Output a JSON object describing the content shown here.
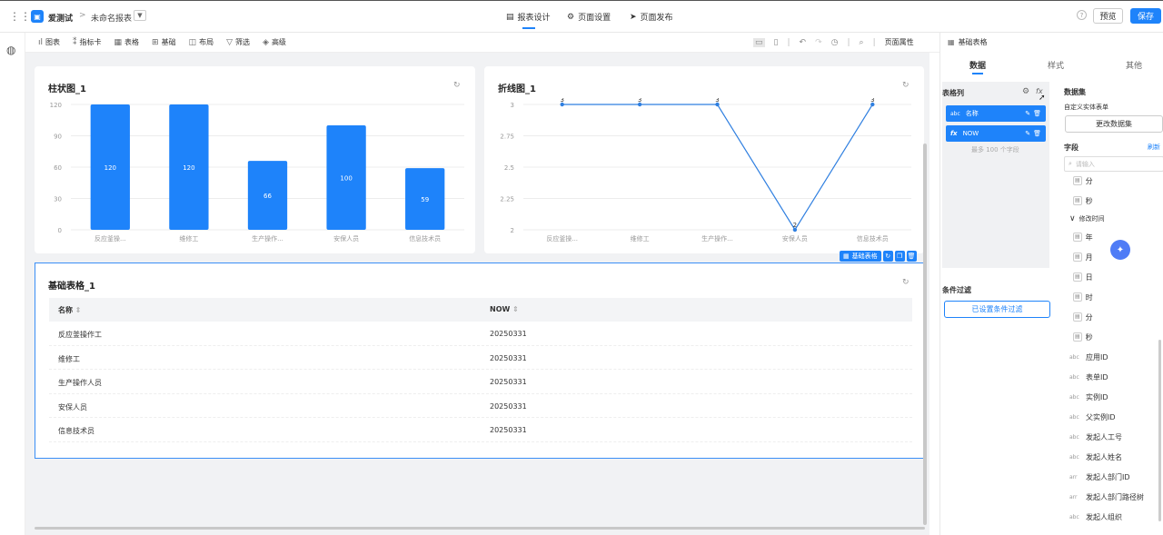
{
  "topbar": {
    "app_name": "爱测试",
    "breadcrumb_sep": ">",
    "report_name": "未命名报表",
    "tabs": [
      {
        "label": "报表设计",
        "active": true
      },
      {
        "label": "页面设置",
        "active": false
      },
      {
        "label": "页面发布",
        "active": false
      }
    ],
    "preview_label": "预览",
    "save_label": "保存"
  },
  "toolbar": {
    "items": [
      {
        "label": "图表",
        "icon": "bar-chart-icon"
      },
      {
        "label": "指标卡",
        "icon": "metric-card-icon"
      },
      {
        "label": "表格",
        "icon": "table-icon"
      },
      {
        "label": "基础",
        "icon": "grid-icon"
      },
      {
        "label": "布局",
        "icon": "layout-icon"
      },
      {
        "label": "筛选",
        "icon": "filter-icon"
      },
      {
        "label": "高级",
        "icon": "layers-icon"
      }
    ],
    "page_props_label": "页面属性"
  },
  "bar_chart": {
    "title": "柱状图_1",
    "chart_data": {
      "type": "bar",
      "categories": [
        "反应釜操...",
        "维修工",
        "生产操作...",
        "安保人员",
        "信息技术员"
      ],
      "values": [
        120,
        120,
        66,
        100,
        59
      ],
      "yticks": [
        0,
        30,
        60,
        90,
        120
      ],
      "ylim": [
        0,
        120
      ],
      "color": "#1e83fa"
    }
  },
  "line_chart": {
    "title": "折线图_1",
    "chart_data": {
      "type": "line",
      "categories": [
        "反应釜操...",
        "维修工",
        "生产操作...",
        "安保人员",
        "信息技术员"
      ],
      "values": [
        3,
        3,
        3,
        2,
        3
      ],
      "yticks": [
        2,
        2.25,
        2.5,
        2.75,
        3
      ],
      "ylim": [
        2,
        3
      ],
      "color": "#2f7fe0"
    }
  },
  "selection_badge": {
    "label": "基础表格"
  },
  "table": {
    "title": "基础表格_1",
    "columns": [
      "名称",
      "NOW"
    ],
    "rows": [
      [
        "反应釜操作工",
        "20250331"
      ],
      [
        "维修工",
        "20250331"
      ],
      [
        "生产操作人员",
        "20250331"
      ],
      [
        "安保人员",
        "20250331"
      ],
      [
        "信息技术员",
        "20250331"
      ]
    ]
  },
  "right_panel": {
    "component_name": "基础表格",
    "tabs": [
      {
        "label": "数据",
        "active": true
      },
      {
        "label": "样式",
        "active": false
      },
      {
        "label": "其他",
        "active": false
      }
    ],
    "columns_title": "表格列",
    "columns": [
      {
        "type": "abc",
        "name": "名称"
      },
      {
        "type": "fx",
        "name": "NOW"
      }
    ],
    "columns_hint": "最多 100 个字段",
    "dataset_title": "数据集",
    "dataset_name": "自定义实体表单",
    "change_dataset_label": "更改数据集",
    "fields_title": "字段",
    "refresh_label": "刷新",
    "search_placeholder": "请输入",
    "fields_top": [
      {
        "type": "date",
        "name": "分"
      },
      {
        "type": "date",
        "name": "秒"
      }
    ],
    "group_label": "修改时间",
    "fields_group": [
      {
        "type": "date",
        "name": "年"
      },
      {
        "type": "date",
        "name": "月"
      },
      {
        "type": "date",
        "name": "日"
      },
      {
        "type": "date",
        "name": "时"
      },
      {
        "type": "date",
        "name": "分"
      },
      {
        "type": "date",
        "name": "秒"
      }
    ],
    "fields_bottom": [
      {
        "type": "abc",
        "name": "应用ID"
      },
      {
        "type": "abc",
        "name": "表单ID"
      },
      {
        "type": "abc",
        "name": "实例ID"
      },
      {
        "type": "abc",
        "name": "父实例ID"
      },
      {
        "type": "abc",
        "name": "发起人工号"
      },
      {
        "type": "abc",
        "name": "发起人姓名"
      },
      {
        "type": "arr",
        "name": "发起人部门ID"
      },
      {
        "type": "arr",
        "name": "发起人部门路径树"
      },
      {
        "type": "abc",
        "name": "发起人组织"
      }
    ],
    "filter_title": "条件过滤",
    "filter_button": "已设置条件过滤"
  }
}
